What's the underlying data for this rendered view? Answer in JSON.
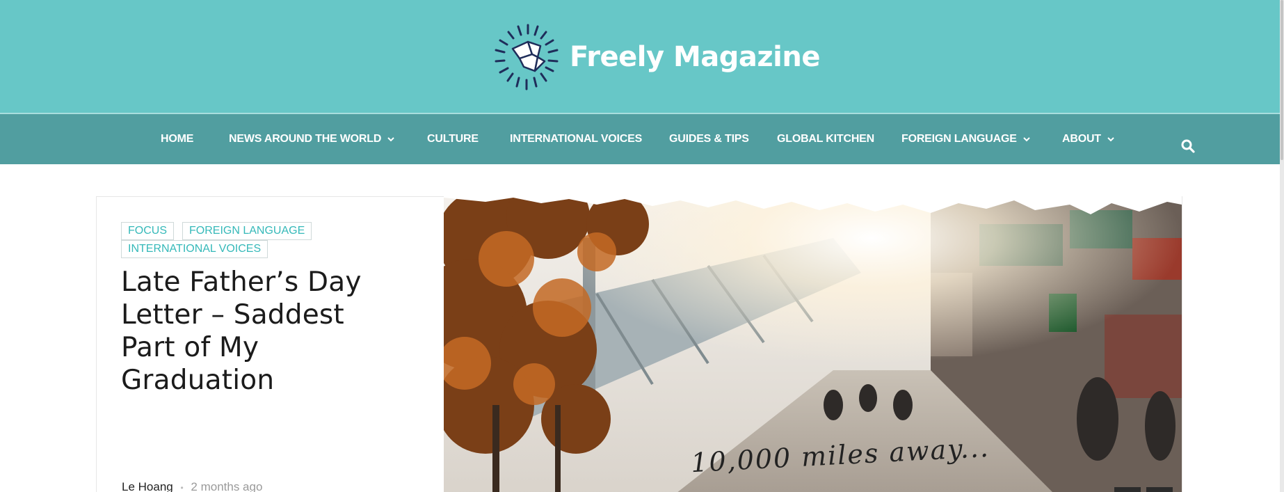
{
  "site": {
    "title": "Freely Magazine",
    "logo_icon": "starburst-bird-logo-icon"
  },
  "colors": {
    "header_bg": "#67c7c7",
    "nav_bg": "#519ea0",
    "tag_text": "#35b9b9"
  },
  "nav": {
    "items": [
      {
        "label": "HOME",
        "has_dropdown": false
      },
      {
        "label": "NEWS AROUND THE WORLD",
        "has_dropdown": true
      },
      {
        "label": "CULTURE",
        "has_dropdown": false
      },
      {
        "label": "INTERNATIONAL VOICES",
        "has_dropdown": false
      },
      {
        "label": "GUIDES & TIPS",
        "has_dropdown": false
      },
      {
        "label": "GLOBAL KITCHEN",
        "has_dropdown": false
      },
      {
        "label": "FOREIGN LANGUAGE",
        "has_dropdown": true
      },
      {
        "label": "ABOUT",
        "has_dropdown": true
      }
    ],
    "search_icon": "search-icon"
  },
  "feature": {
    "tags": [
      "FOCUS",
      "FOREIGN LANGUAGE",
      "INTERNATIONAL VOICES"
    ],
    "title": "Late Father’s Day Letter – Saddest Part of My Graduation",
    "author": "Le Hoang",
    "separator": "•",
    "time": "2 months ago",
    "image_caption": "10,000 miles away..."
  }
}
